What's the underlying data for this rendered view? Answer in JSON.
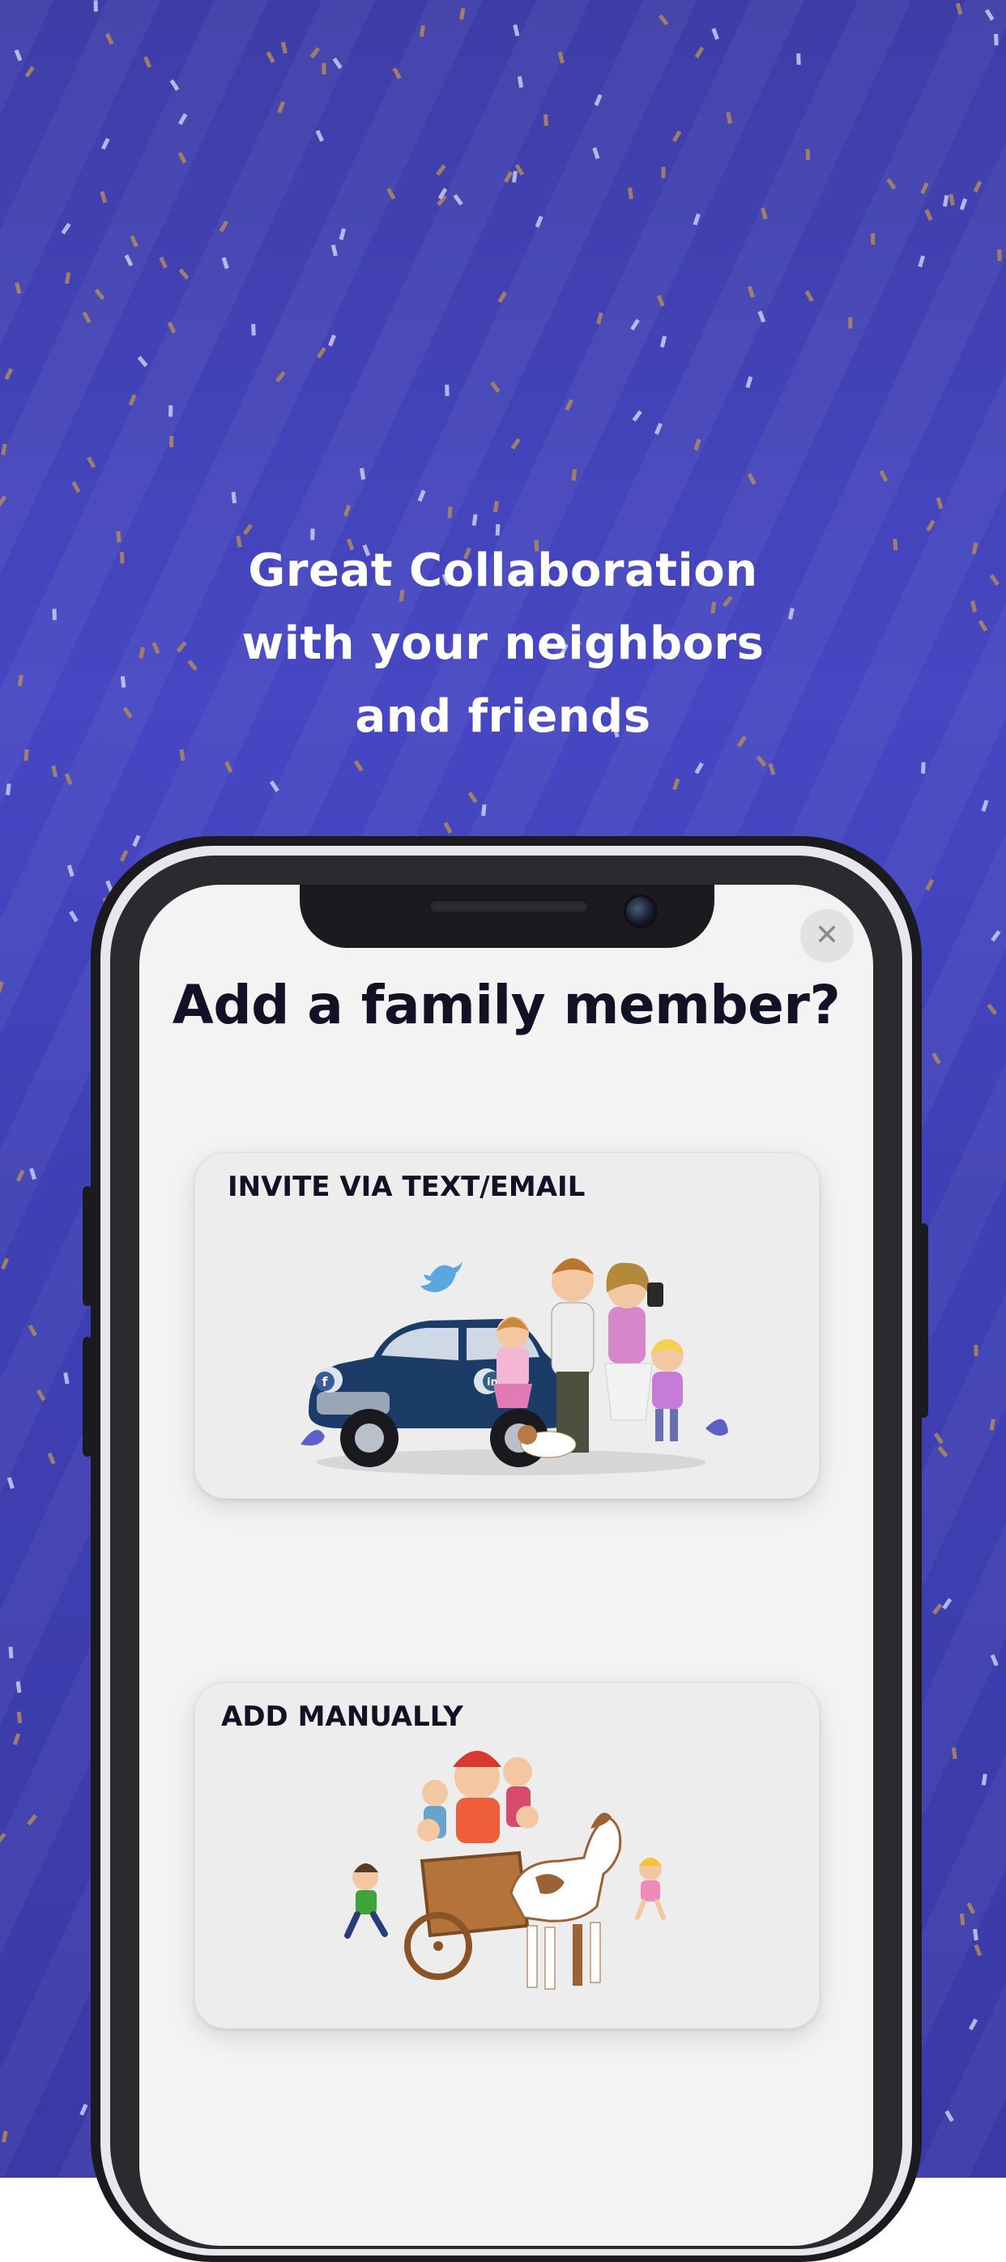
{
  "headline": {
    "line1": "Great Collaboration",
    "line2": "with your neighbors",
    "line3": "and friends"
  },
  "dialog": {
    "title": "Add a family member?",
    "close_symbol": "✕",
    "options": [
      {
        "label": "INVITE VIA TEXT/EMAIL",
        "illustration": "family-with-car-illustration"
      },
      {
        "label": "ADD MANUALLY",
        "illustration": "family-on-horse-cart-illustration"
      }
    ],
    "social_badges": [
      "f",
      "in"
    ]
  },
  "colors": {
    "background": "#4142b8",
    "confetti_gold": "#b08a5c",
    "confetti_light": "#c9cbf0",
    "title_text": "#121226",
    "card_bg": "#ededed"
  }
}
